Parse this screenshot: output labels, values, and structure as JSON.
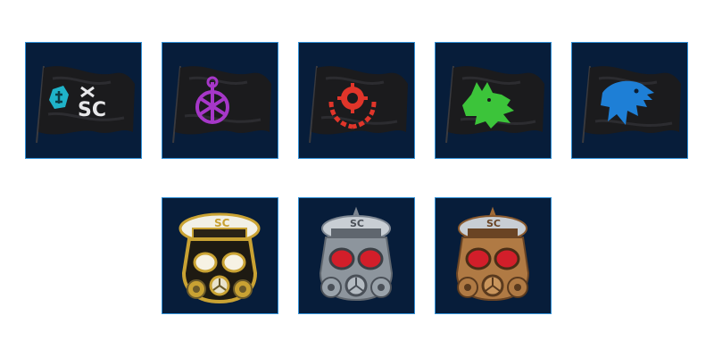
{
  "colors": {
    "tile_background": "#071d3a",
    "tile_border": "#2f8fd6",
    "flag_cloth": "#1b1b1d",
    "emblem_cyan": "#1fb3c9",
    "emblem_purple": "#a637c8",
    "emblem_red": "#e0352a",
    "emblem_green": "#3cc43a",
    "emblem_blue": "#1e7fd6",
    "gold": "#c9a233",
    "silver": "#9aa3ab",
    "bronze": "#b07a44",
    "lens_red": "#d21e2a"
  },
  "flags": [
    {
      "icon": "sc-faction-flag-icon",
      "emblem_color": "emblem_cyan"
    },
    {
      "icon": "purple-faction-flag-icon",
      "emblem_color": "emblem_purple"
    },
    {
      "icon": "red-crosshair-laurel-flag-icon",
      "emblem_color": "emblem_red"
    },
    {
      "icon": "green-wolf-flag-icon",
      "emblem_color": "emblem_green"
    },
    {
      "icon": "blue-eagle-flag-icon",
      "emblem_color": "emblem_blue"
    }
  ],
  "masks": [
    {
      "icon": "gold-gasmask-officer-cap-icon",
      "tier": "gold"
    },
    {
      "icon": "silver-gasmask-officer-cap-icon",
      "tier": "silver"
    },
    {
      "icon": "bronze-gasmask-officer-cap-icon",
      "tier": "bronze"
    }
  ]
}
